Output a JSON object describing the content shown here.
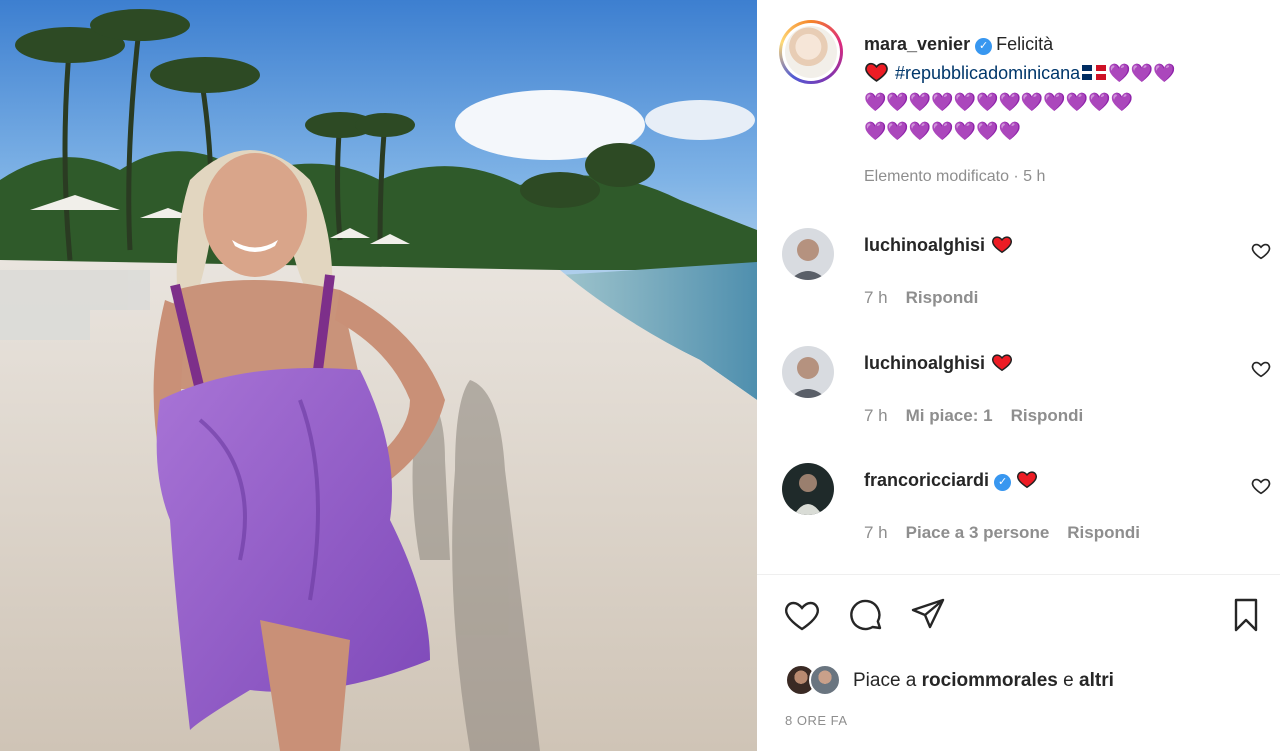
{
  "post": {
    "username": "mara_venier",
    "caption_title": "Felicità",
    "hashtag": "#repubblicadominicana",
    "purple_hearts_line1": "💜💜💜",
    "purple_hearts_line2": "💜💜💜💜💜💜💜💜💜💜💜💜",
    "purple_hearts_line3": "💜💜💜💜💜💜💜",
    "meta": "Elemento modificato · 5 h"
  },
  "comments": [
    {
      "username": "luchinoalghisi",
      "time": "7 h",
      "likes": "",
      "reply": "Rispondi"
    },
    {
      "username": "luchinoalghisi",
      "time": "7 h",
      "likes": "Mi piace: 1",
      "reply": "Rispondi"
    },
    {
      "username": "francoricciardi",
      "time": "7 h",
      "likes": "Piace a 3 persone",
      "reply": "Rispondi"
    }
  ],
  "likes_summary": {
    "prefix": "Piace a",
    "user": "rociommorales",
    "conj": "e",
    "others": "altri"
  },
  "timestamp": "8 ORE FA",
  "icons": [
    "heart-icon",
    "comment-icon",
    "share-icon",
    "bookmark-icon",
    "verified-badge-icon"
  ],
  "colors": {
    "accent": "#3897f0",
    "link": "#00376b",
    "muted": "#8e8e8e",
    "heart_red": "#ed1c24"
  }
}
